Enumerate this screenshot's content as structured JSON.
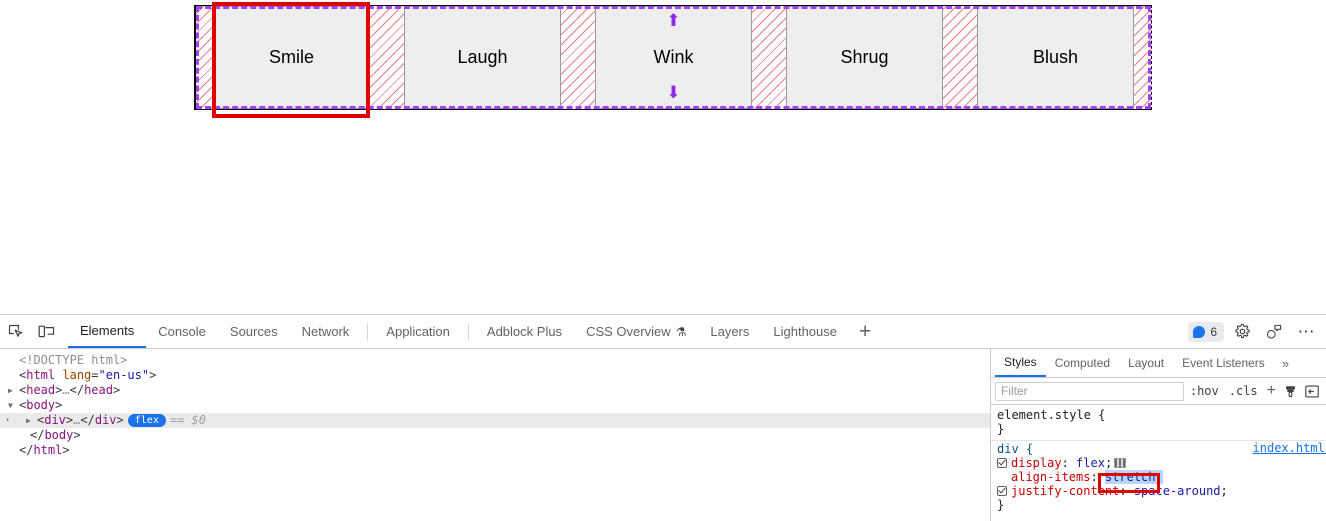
{
  "page": {
    "flex_items": [
      {
        "label": "Smile",
        "has_stretch_arrows": false,
        "annotated": true
      },
      {
        "label": "Laugh",
        "has_stretch_arrows": false,
        "annotated": false
      },
      {
        "label": "Wink",
        "has_stretch_arrows": true,
        "annotated": false
      },
      {
        "label": "Shrug",
        "has_stretch_arrows": false,
        "annotated": false
      },
      {
        "label": "Blush",
        "has_stretch_arrows": false,
        "annotated": false
      }
    ],
    "overlay": {
      "container_outline_color": "#a142f4",
      "gap_hatch_color": "#e76478",
      "stretch_arrow_up": "⬆",
      "stretch_arrow_down": "⬇",
      "annotation_color": "#e00000"
    }
  },
  "devtools": {
    "toolbar": {
      "inspect_icon": "inspect-element-icon",
      "device_icon": "device-toolbar-icon",
      "tabs": [
        {
          "label": "Elements",
          "active": true,
          "icon": ""
        },
        {
          "label": "Console",
          "active": false,
          "icon": ""
        },
        {
          "label": "Sources",
          "active": false,
          "icon": ""
        },
        {
          "label": "Network",
          "active": false,
          "icon": ""
        },
        {
          "label": "Application",
          "active": false,
          "icon": ""
        },
        {
          "label": "Adblock Plus",
          "active": false,
          "icon": ""
        },
        {
          "label": "CSS Overview",
          "active": false,
          "icon": "⚗"
        },
        {
          "label": "Layers",
          "active": false,
          "icon": ""
        },
        {
          "label": "Lighthouse",
          "active": false,
          "icon": ""
        }
      ],
      "add_tab_label": "+",
      "issues_count": "6",
      "settings_icon": "gear-icon",
      "feedback_icon": "feedback-icon",
      "more_icon": "⋯"
    },
    "dom": {
      "lines": [
        {
          "id": "doctype",
          "text": "<!DOCTYPE html>"
        },
        {
          "id": "html_open",
          "text": "<html lang=\"en-us\">"
        },
        {
          "id": "head",
          "text": "<head>…</head>"
        },
        {
          "id": "body_open",
          "text": "<body>"
        },
        {
          "id": "div_selected",
          "text": "<div>…</div>",
          "badge": "flex",
          "suffix": "== $0"
        },
        {
          "id": "body_close",
          "text": "</body>"
        },
        {
          "id": "html_close",
          "text": "</html>"
        }
      ],
      "tag_html": "html",
      "attr_lang_name": "lang",
      "attr_lang_value": "\"en-us\"",
      "tag_head": "head",
      "tag_body": "body",
      "tag_div": "div",
      "ellipsis": "…",
      "flex_badge": "flex",
      "selected_suffix": "== $0",
      "doctype_text": "<!DOCTYPE html>"
    },
    "styles": {
      "tabs": [
        {
          "label": "Styles",
          "active": true
        },
        {
          "label": "Computed",
          "active": false
        },
        {
          "label": "Layout",
          "active": false
        },
        {
          "label": "Event Listeners",
          "active": false
        }
      ],
      "more_tabs": "»",
      "filter_placeholder": "Filter",
      "hov_label": ":hov",
      "cls_label": ".cls",
      "new_rule_label": "+",
      "color_picker_icon": "paint-brush-icon",
      "sidebar_toggle_icon": "toggle-sidebar-icon",
      "rules": [
        {
          "selector": "element.style {",
          "close": "}",
          "source": "",
          "declarations": []
        },
        {
          "selector": "div {",
          "close": "}",
          "source": "index.html:",
          "declarations": [
            {
              "checkbox": true,
              "property": "display",
              "value": "flex",
              "swatch": true,
              "selected": false
            },
            {
              "checkbox": false,
              "property": "align-items",
              "value": "stretch",
              "swatch": false,
              "selected": true
            },
            {
              "checkbox": true,
              "property": "justify-content",
              "value": "space-around",
              "swatch": false,
              "selected": false
            }
          ]
        }
      ]
    }
  }
}
